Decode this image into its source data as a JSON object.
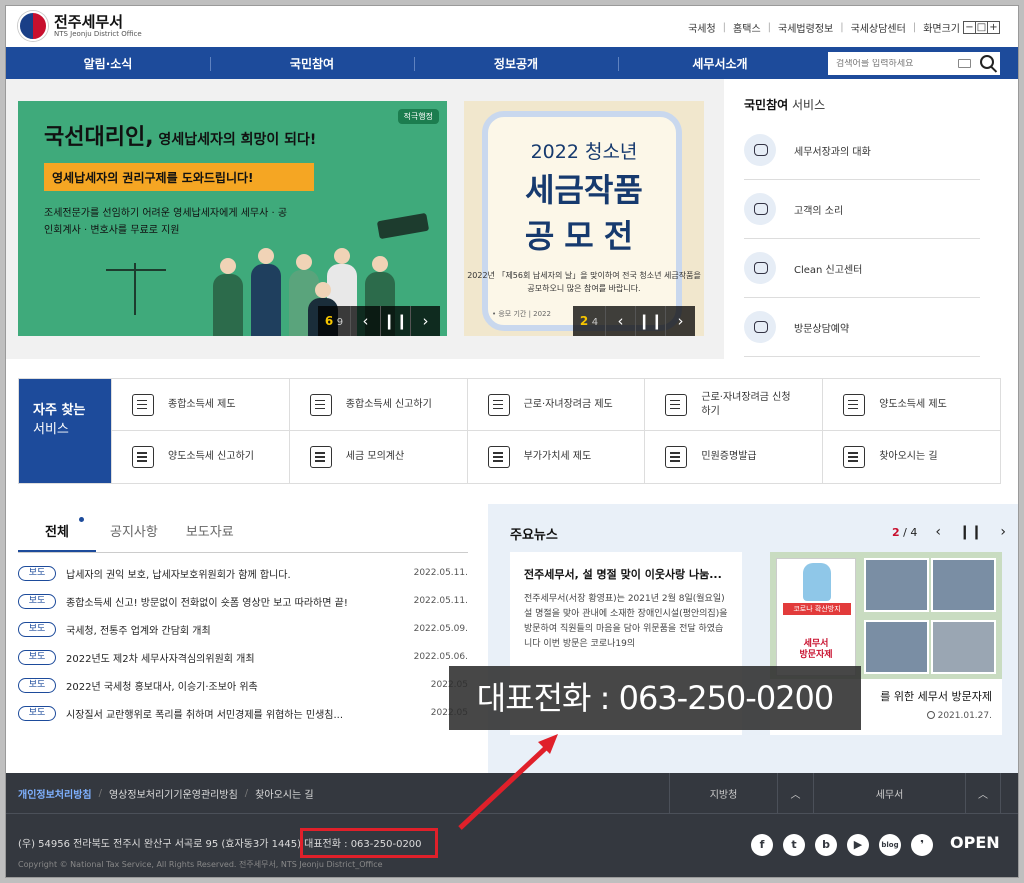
{
  "header": {
    "logo_name": "전주세무서",
    "logo_sub": "NTS Jeonju District Office",
    "util_links": [
      "국세청",
      "홈택스",
      "국세법령정보",
      "국세상담센터",
      "화면크기"
    ],
    "size_controls": [
      "−",
      "□",
      "+"
    ]
  },
  "nav": {
    "items": [
      "알림·소식",
      "국민참여",
      "정보공개",
      "세무서소개"
    ],
    "search_placeholder": "검색어를 입력하세요"
  },
  "banner1": {
    "tag": "적극행정",
    "title": "국선대리인,",
    "title_small": " 영세납세자의 희망이 되다!",
    "strip": "영세납세자의 권리구제를 도와드립니다!",
    "desc": "조세전문가를 선임하기 어려운 영세납세자에게 세무사 · 공인회계사 · 변호사를 무료로 지원",
    "current": "6",
    "total": "9"
  },
  "banner2": {
    "year": "2022 청소년",
    "big1": "세금작품",
    "big2": "공모전",
    "desc": "2022년 「제56회 납세자의 날」을 맞이하여 전국 청소년 세금작품을 공모하오니 많은 참여를 바랍니다.",
    "period": "• 응모 기간 | 2022",
    "current": "2",
    "total": "4"
  },
  "side": {
    "title_bold": "국민참여",
    "title_rest": " 서비스",
    "items": [
      "세무서장과의 대화",
      "고객의 소리",
      "Clean 신고센터",
      "방문상담예약"
    ],
    "icons": [
      "chat-icon",
      "pen-icon",
      "siren-icon",
      "headset-icon"
    ]
  },
  "freq": {
    "head1": "자주 찾는",
    "head2": "서비스",
    "items": [
      "종합소득세 제도",
      "종합소득세 신고하기",
      "근로·자녀장려금 제도",
      "근로·자녀장려금 신청하기",
      "양도소득세 제도",
      "양도소득세 신고하기",
      "세금 모의계산",
      "부가가치세 제도",
      "민원증명발급",
      "찾아오시는 길"
    ]
  },
  "notice": {
    "tabs": [
      "전체",
      "공지사항",
      "보도자료"
    ],
    "badge": "보도",
    "rows": [
      {
        "title": "납세자의 권익 보호, 납세자보호위원회가 함께 합니다.",
        "date": "2022.05.11."
      },
      {
        "title": "종합소득세 신고! 방문없이 전화없이 숏폼 영상만 보고 따라하면 끝!",
        "date": "2022.05.11."
      },
      {
        "title": "국세청, 전통주 업계와 간담회 개최",
        "date": "2022.05.09."
      },
      {
        "title": "2022년도 제2차 세무사자격심의위원회 개최",
        "date": "2022.05.06."
      },
      {
        "title": "2022년 국세청 홍보대사, 이승기·조보아 위촉",
        "date": "2022.05"
      },
      {
        "title": "시장질서 교란행위로 폭리를 취하며 서민경제를 위협하는 민생침...",
        "date": "2022.05"
      }
    ]
  },
  "major": {
    "title": "주요뉴스",
    "current": "2",
    "total": "4",
    "card1_title": "전주세무서, 설 명절 맞이 이웃사랑 나눔...",
    "card1_body": "전주세무서(서장 황영표)는 2021년 2월 8일(월요일) 설 명절을 맞아 관내에 소재한 장애인시설(평안의집)을 방문하여 직원들의 마음을 담아 위문품을 전달 하였습니다 이번 방문은 코로나19의",
    "card2_title": "를 위한 세무서 방문자제",
    "card2_date": "2021.01.27.",
    "poster_red": "코로나 확산방지",
    "poster_text": "세무서\n방문자제"
  },
  "overlay": {
    "phone": "대표전화 : 063-250-0200"
  },
  "footer": {
    "links": [
      "개인정보처리방침",
      "영상정보처리기기운영관리방침",
      "찾아오시는 길"
    ],
    "selects": [
      "지방청",
      "세무서"
    ],
    "address": "(우) 54956 전라북도 전주시 완산구 서곡로 95 (효자동3가 1445) 대표전화 : 063-250-0200",
    "copyright": "Copyright © National Tax Service, All Rights Reserved. 전주세무서, NTS Jeonju District_Office",
    "sns": [
      "f",
      "t",
      "b",
      "▶",
      "blog",
      "❜"
    ],
    "open": "OPEN"
  }
}
